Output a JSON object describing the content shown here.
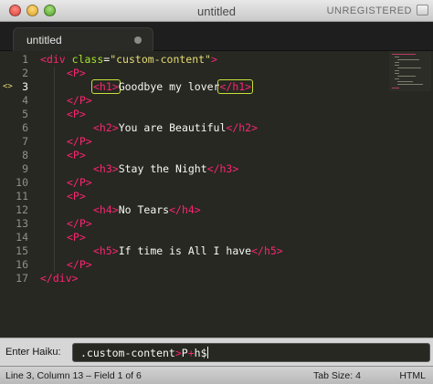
{
  "window": {
    "title": "untitled",
    "badge": "UNREGISTERED"
  },
  "tab": {
    "label": "untitled"
  },
  "editor": {
    "line_numbers": [
      "1",
      "2",
      "3",
      "4",
      "5",
      "6",
      "7",
      "8",
      "9",
      "10",
      "11",
      "12",
      "13",
      "14",
      "15",
      "16",
      "17"
    ],
    "active_line": 3,
    "active_marker": "<>",
    "lines": {
      "l1": {
        "open": "<",
        "tag": "div",
        "attr": " class",
        "eq": "=",
        "val": "\"custom-content\"",
        "close": ">"
      },
      "p_open": "<P>",
      "p_close": "</P>",
      "l3": {
        "open": "<h1>",
        "text": "Goodbye my lover",
        "close": "</h1>"
      },
      "l6": {
        "open": "<h2>",
        "text": "You are Beautiful",
        "close": "</h2>"
      },
      "l9": {
        "open": "<h3>",
        "text": "Stay the Night",
        "close": "</h3>"
      },
      "l12": {
        "open": "<h4>",
        "text": "No Tears",
        "close": "</h4>"
      },
      "l15": {
        "open": "<h5>",
        "text": "If time is All I have",
        "close": "</h5>"
      },
      "l17": "</div>"
    }
  },
  "haiku_panel": {
    "label": "Enter Haiku:",
    "value_prefix": ".custom-content",
    "value_op1": ">",
    "value_mid": "P",
    "value_op2": "+",
    "value_suffix": "h$"
  },
  "status_bar": {
    "position": "Line 3, Column 13 – Field 1 of 6",
    "tab_size": "Tab Size: 4",
    "syntax": "HTML"
  },
  "colors": {
    "editor_bg": "#272822",
    "tag": "#f92672",
    "attribute": "#a6e22e",
    "string": "#e6db74",
    "text": "#f8f8f2",
    "field_highlight": "#c8e03a"
  }
}
